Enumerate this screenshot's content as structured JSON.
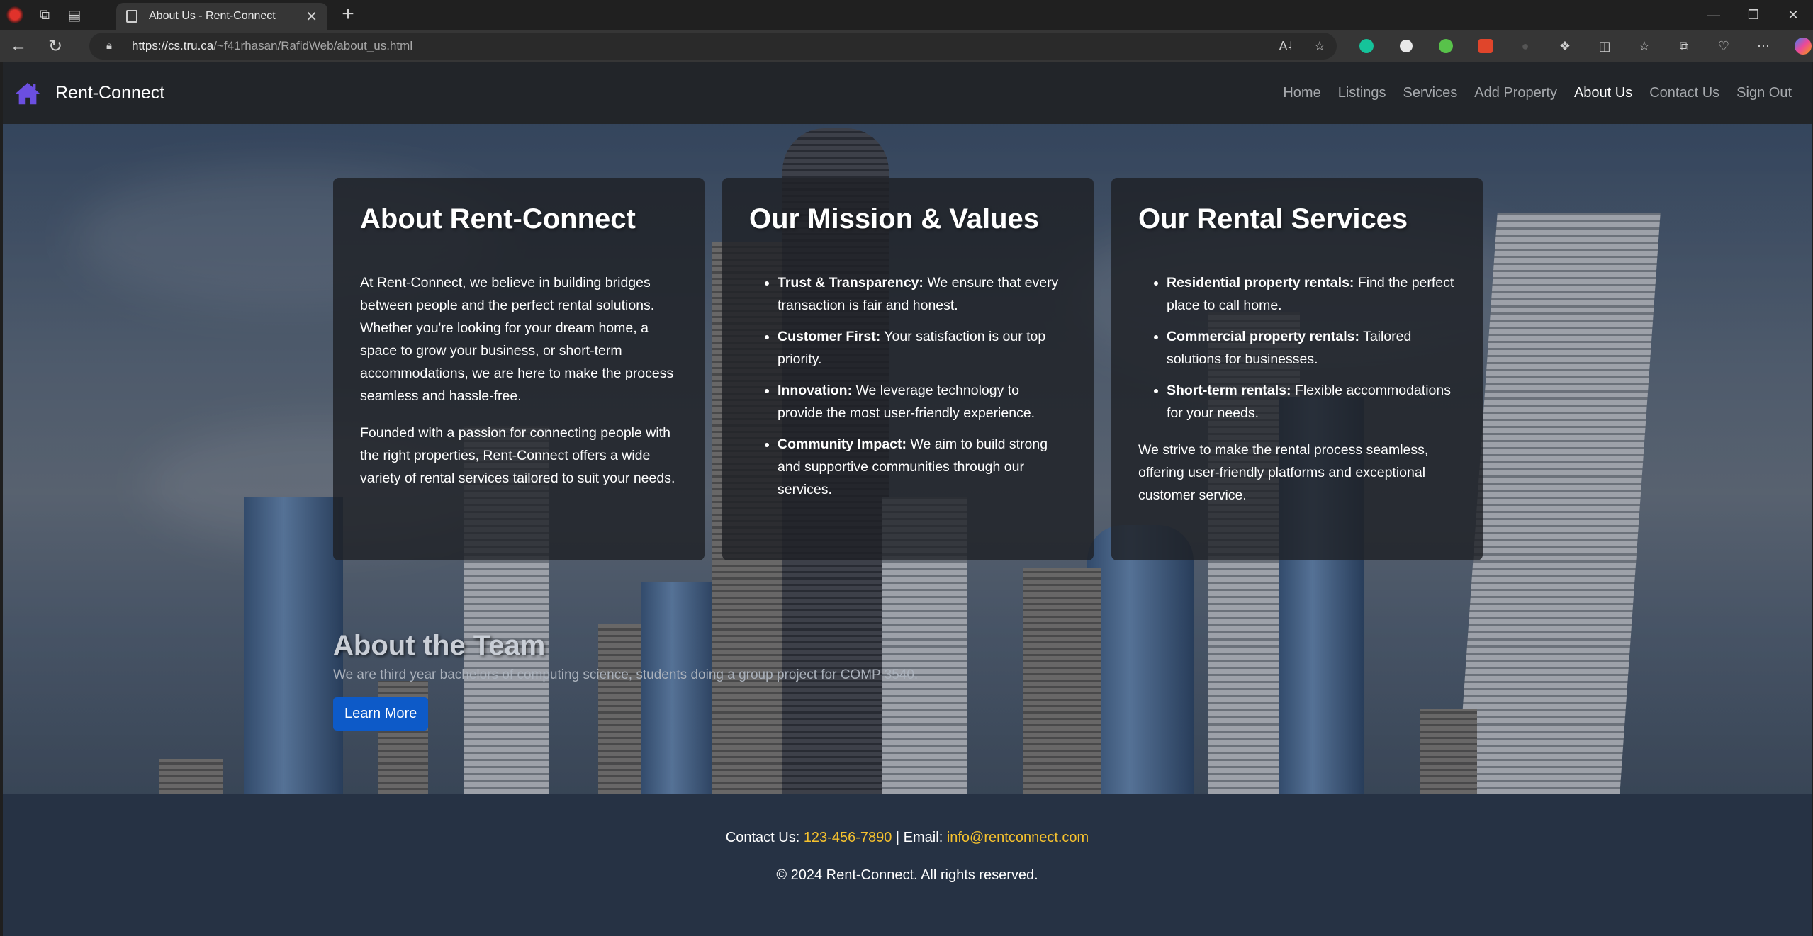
{
  "browser": {
    "tab_title": "About Us - Rent-Connect",
    "url_host": "https://cs.tru.ca",
    "url_path": "/~f41rhasan/RafidWeb/about_us.html"
  },
  "site": {
    "brand": "Rent-Connect",
    "nav": [
      {
        "label": "Home",
        "active": false
      },
      {
        "label": "Listings",
        "active": false
      },
      {
        "label": "Services",
        "active": false
      },
      {
        "label": "Add Property",
        "active": false
      },
      {
        "label": "About Us",
        "active": true
      },
      {
        "label": "Contact Us",
        "active": false
      },
      {
        "label": "Sign Out",
        "active": false
      }
    ]
  },
  "cards": {
    "about": {
      "title": "About Rent-Connect",
      "p1": "At Rent-Connect, we believe in building bridges between people and the perfect rental solutions. Whether you're looking for your dream home, a space to grow your business, or short-term accommodations, we are here to make the process seamless and hassle-free.",
      "p2": "Founded with a passion for connecting people with the right properties, Rent-Connect offers a wide variety of rental services tailored to suit your needs."
    },
    "mission": {
      "title": "Our Mission & Values",
      "items": [
        {
          "label": "Trust & Transparency:",
          "text": " We ensure that every transaction is fair and honest."
        },
        {
          "label": "Customer First:",
          "text": " Your satisfaction is our top priority."
        },
        {
          "label": "Innovation:",
          "text": " We leverage technology to provide the most user-friendly experience."
        },
        {
          "label": "Community Impact:",
          "text": " We aim to build strong and supportive communities through our services."
        }
      ]
    },
    "services": {
      "title": "Our Rental Services",
      "items": [
        {
          "label": "Residential property rentals:",
          "text": " Find the perfect place to call home."
        },
        {
          "label": "Commercial property rentals:",
          "text": " Tailored solutions for businesses."
        },
        {
          "label": "Short-term rentals:",
          "text": " Flexible accommodations for your needs."
        }
      ],
      "closing": "We strive to make the rental process seamless, offering user-friendly platforms and exceptional customer service."
    }
  },
  "team": {
    "title": "About the Team",
    "text": "We are third year bachelors of computing science, students doing a group project for COMP 3540.",
    "button": "Learn More"
  },
  "footer": {
    "contact_prefix": "Contact Us: ",
    "phone": "123-456-7890",
    "separator": " | Email: ",
    "email": "info@rentconnect.com",
    "copyright": "© 2024 Rent-Connect. All rights reserved."
  }
}
